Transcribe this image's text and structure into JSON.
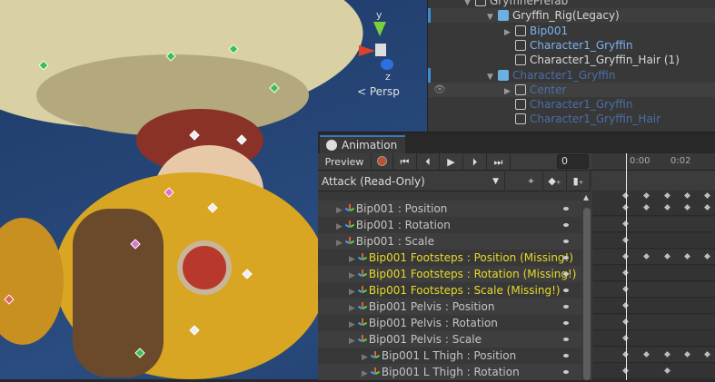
{
  "scene": {
    "view_mode": "Persp",
    "axes": {
      "y": "y",
      "z": "z",
      "x": "x"
    }
  },
  "hierarchy": {
    "items": [
      {
        "label": "GryffinePrefab",
        "indent": 0,
        "color": "#c4c4c4",
        "arrow": "▼",
        "prefab": false
      },
      {
        "label": "Gryffin_Rig(Legacy)",
        "indent": 1,
        "color": "#d8d8d8",
        "arrow": "▼",
        "prefab": true
      },
      {
        "label": "Bip001",
        "indent": 2,
        "color": "#7fb1f0",
        "arrow": "▶",
        "prefab": false
      },
      {
        "label": "Character1_Gryffin",
        "indent": 2,
        "color": "#7fb1f0",
        "arrow": "",
        "prefab": false
      },
      {
        "label": "Character1_Gryffin_Hair (1)",
        "indent": 2,
        "color": "#d8d8d8",
        "arrow": "",
        "prefab": false
      },
      {
        "label": "Character1_Gryffin",
        "indent": 1,
        "color": "#4a6fa8",
        "arrow": "▼",
        "prefab": true
      },
      {
        "label": "Center",
        "indent": 2,
        "color": "#4a6fa8",
        "arrow": "▶",
        "prefab": false
      },
      {
        "label": "Character1_Gryffin",
        "indent": 2,
        "color": "#4a6fa8",
        "arrow": "",
        "prefab": false
      },
      {
        "label": "Character1_Gryffin_Hair",
        "indent": 2,
        "color": "#4a6fa8",
        "arrow": "",
        "prefab": false
      }
    ]
  },
  "animation": {
    "tab_label": "Animation",
    "preview_label": "Preview",
    "frame_value": "0",
    "clip": "Attack (Read-Only)",
    "time_labels": [
      "0:00",
      "0:02"
    ],
    "properties": [
      {
        "label": "Bip001 : Position",
        "indent": 0,
        "missing": false,
        "keys": [
          0,
          1,
          2,
          3,
          4
        ]
      },
      {
        "label": "Bip001 : Rotation",
        "indent": 0,
        "missing": false,
        "keys": [
          0
        ]
      },
      {
        "label": "Bip001 : Scale",
        "indent": 0,
        "missing": false,
        "keys": [
          0
        ]
      },
      {
        "label": "Bip001 Footsteps : Position (Missing!)",
        "indent": 1,
        "missing": true,
        "keys": [
          0,
          1,
          2,
          3,
          4
        ]
      },
      {
        "label": "Bip001 Footsteps : Rotation (Missing!)",
        "indent": 1,
        "missing": true,
        "keys": [
          0
        ]
      },
      {
        "label": "Bip001 Footsteps : Scale (Missing!)",
        "indent": 1,
        "missing": true,
        "keys": [
          0
        ]
      },
      {
        "label": "Bip001 Pelvis : Position",
        "indent": 1,
        "missing": false,
        "keys": [
          0
        ]
      },
      {
        "label": "Bip001 Pelvis : Rotation",
        "indent": 1,
        "missing": false,
        "keys": [
          0
        ]
      },
      {
        "label": "Bip001 Pelvis : Scale",
        "indent": 1,
        "missing": false,
        "keys": [
          0
        ]
      },
      {
        "label": "Bip001 L Thigh : Position",
        "indent": 2,
        "missing": false,
        "keys": [
          0,
          1,
          2,
          3,
          4
        ]
      },
      {
        "label": "Bip001 L Thigh : Rotation",
        "indent": 2,
        "missing": false,
        "keys": [
          0,
          2
        ]
      }
    ],
    "summary_keys": [
      0,
      1,
      2,
      3,
      4
    ]
  }
}
